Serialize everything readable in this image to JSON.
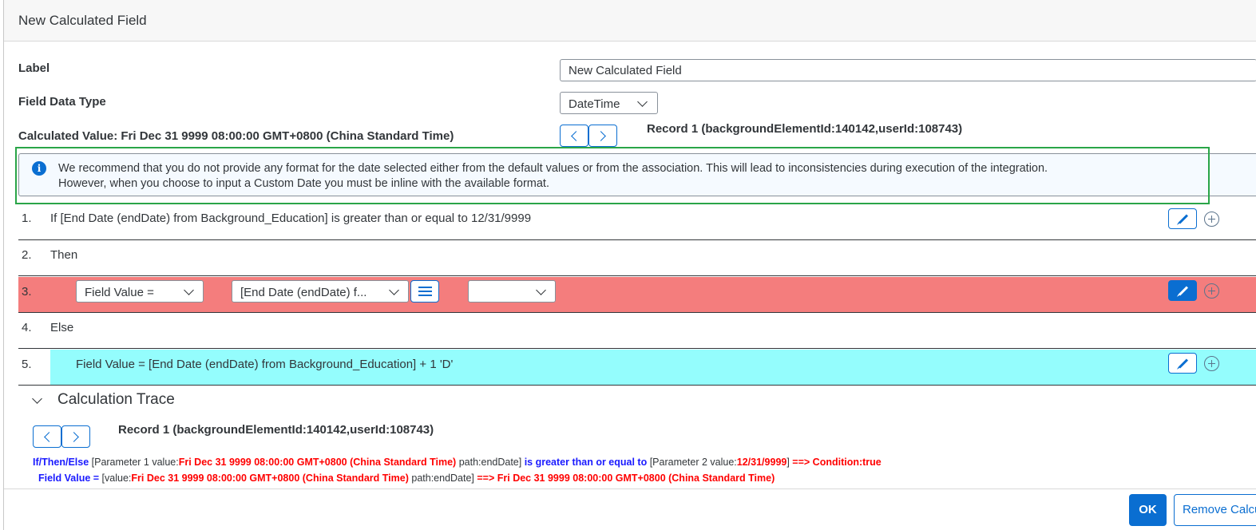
{
  "dialog": {
    "title": "New Calculated Field"
  },
  "form": {
    "label_caption": "Label",
    "label_value": "New Calculated Field",
    "data_type_caption": "Field Data Type",
    "data_type_value": "DateTime",
    "calculated_value": "Calculated Value: Fri Dec 31 9999 08:00:00 GMT+0800 (China Standard Time)",
    "record_title": "Record 1 (backgroundElementId:140142,userId:108743)"
  },
  "info_message": {
    "line1": "We recommend that you do not provide any format for the date selected either from the default values or from the association. This will lead to inconsistencies during execution of the integration.",
    "line2": "However, when you choose to input a Custom Date you must be inline with the available format."
  },
  "rules": [
    {
      "num": "1.",
      "text": "If [End Date (endDate) from Background_Education] is greater than or equal to 12/31/9999"
    },
    {
      "num": "2.",
      "text": "Then"
    },
    {
      "num": "3.",
      "field_select": "Field Value =",
      "source_select": "[End Date (endDate) f...",
      "third_select": ""
    },
    {
      "num": "4.",
      "text": "Else"
    },
    {
      "num": "5.",
      "text": "Field Value = [End Date (endDate) from Background_Education] + 1 'D'"
    }
  ],
  "trace": {
    "title": "Calculation Trace",
    "record_title": "Record 1 (backgroundElementId:140142,userId:108743)",
    "line1": {
      "op": "If/Then/Else",
      "p1_prefix": " [Parameter 1 value:",
      "p1_value": "Fri Dec 31 9999 08:00:00 GMT+0800 (China Standard Time)",
      "p1_suffix": " path:endDate] ",
      "comparator": "is greater than or equal to",
      "p2_prefix": " [Parameter 2 value:",
      "p2_value": "12/31/9999",
      "p2_suffix": "] ",
      "result": "==> Condition:true"
    },
    "line2": {
      "op": "Field Value =",
      "prefix": " [value:",
      "value": "Fri Dec 31 9999 08:00:00 GMT+0800 (China Standard Time)",
      "suffix": " path:endDate] ",
      "result": "==> Fri Dec 31 9999 08:00:00 GMT+0800 (China Standard Time)"
    }
  },
  "footer": {
    "ok_label": "OK",
    "remove_label": "Remove Calculated Field"
  },
  "colors": {
    "accent": "#0a6ed1",
    "error_row": "#f47d7d",
    "highlight_row": "#94fdfd",
    "focus_frame": "#2aa548"
  },
  "icons": {
    "info": "info-icon",
    "edit": "pencil-icon",
    "add": "add-circle-icon",
    "menu": "menu-icon",
    "prev": "chevron-left-icon",
    "next": "chevron-right-icon"
  }
}
